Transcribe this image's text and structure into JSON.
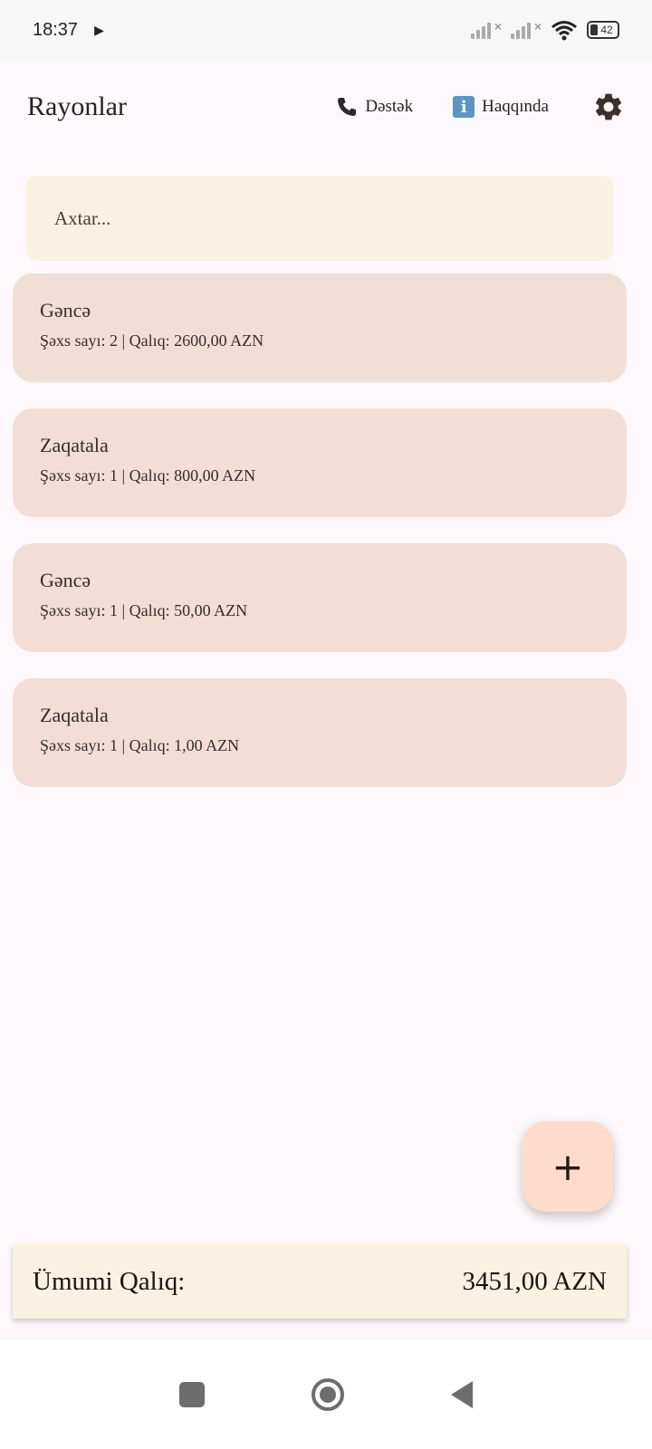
{
  "status_bar": {
    "time": "18:37",
    "play_icon": "▶",
    "battery_level": "42"
  },
  "app_bar": {
    "title": "Rayonlar",
    "support_label": "Dəstək",
    "about_label": "Haqqında",
    "info_glyph": "i"
  },
  "search": {
    "placeholder": "Axtar..."
  },
  "regions": [
    {
      "name": "Gəncə",
      "summary": "Şəxs sayı: 2  |  Qalıq: 2600,00 AZN"
    },
    {
      "name": "Zaqatala",
      "summary": "Şəxs sayı: 1  |  Qalıq: 800,00 AZN"
    },
    {
      "name": "Gəncə",
      "summary": "Şəxs sayı: 1  |  Qalıq: 50,00 AZN"
    },
    {
      "name": "Zaqatala",
      "summary": "Şəxs sayı: 1  |  Qalıq: 1,00 AZN"
    }
  ],
  "fab": {
    "label": "+"
  },
  "total": {
    "label": "Ümumi Qalıq:",
    "value": "3451,00 AZN"
  },
  "colors": {
    "card_bg": "#f2ded4",
    "search_bg": "#faf2e0",
    "fab_bg": "#fddccb"
  }
}
